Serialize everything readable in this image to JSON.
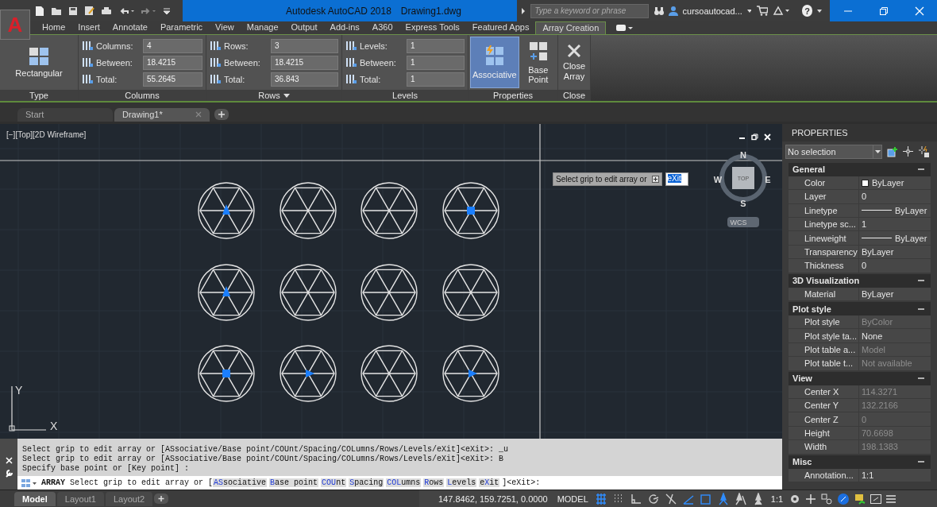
{
  "title_bar": {
    "app_letter": "A",
    "title": "Autodesk AutoCAD 2018",
    "file": "Drawing1.dwg",
    "search": {
      "placeholder": "Type a keyword or phrase"
    },
    "user": "cursoautocad...",
    "help": "?"
  },
  "ribbon_tabs": [
    {
      "label": "Home",
      "selected": false
    },
    {
      "label": "Insert",
      "selected": false
    },
    {
      "label": "Annotate",
      "selected": false
    },
    {
      "label": "Parametric",
      "selected": false
    },
    {
      "label": "View",
      "selected": false
    },
    {
      "label": "Manage",
      "selected": false
    },
    {
      "label": "Output",
      "selected": false
    },
    {
      "label": "Add-ins",
      "selected": false
    },
    {
      "label": "A360",
      "selected": false
    },
    {
      "label": "Express Tools",
      "selected": false
    },
    {
      "label": "Featured Apps",
      "selected": false
    },
    {
      "label": "Array Creation",
      "selected": true
    }
  ],
  "ribbon": {
    "type_panel": {
      "title": "Type",
      "button": "Rectangular"
    },
    "groups": [
      {
        "title": "Columns",
        "has_menu": false,
        "fields": [
          {
            "label": "Columns:",
            "value": "4"
          },
          {
            "label": "Between:",
            "value": "18.4215"
          },
          {
            "label": "Total:",
            "value": "55.2645"
          }
        ]
      },
      {
        "title": "Rows",
        "has_menu": true,
        "fields": [
          {
            "label": "Rows:",
            "value": "3"
          },
          {
            "label": "Between:",
            "value": "18.4215"
          },
          {
            "label": "Total:",
            "value": "36.843"
          }
        ]
      },
      {
        "title": "Levels",
        "has_menu": false,
        "fields": [
          {
            "label": "Levels:",
            "value": "1"
          },
          {
            "label": "Between:",
            "value": "1"
          },
          {
            "label": "Total:",
            "value": "1"
          }
        ]
      }
    ],
    "properties_panel": {
      "title": "Properties",
      "buttons": [
        {
          "label": "Associative",
          "selected": true
        },
        {
          "label": "Base Point",
          "selected": false
        }
      ]
    },
    "close_panel": {
      "title": "Close",
      "button": "Close Array"
    }
  },
  "doc_tabs": [
    {
      "label": "Start",
      "selected": false,
      "closable": false
    },
    {
      "label": "Drawing1*",
      "selected": true,
      "closable": true
    }
  ],
  "viewport": {
    "label": "[−][Top][2D Wireframe]",
    "tooltip": {
      "text": "Select grip to edit array or",
      "input": "eXit"
    },
    "viewcube": {
      "north": "N",
      "south": "S",
      "east": "E",
      "west": "W",
      "face": "TOP",
      "ucs": "WCS"
    },
    "ucs_icon": {
      "x": "X",
      "y": "Y"
    },
    "items": [
      {
        "kind": "up"
      },
      {
        "kind": "plain"
      },
      {
        "kind": "plain"
      },
      {
        "kind": "square"
      },
      {
        "kind": "up"
      },
      {
        "kind": "plain"
      },
      {
        "kind": "plain"
      },
      {
        "kind": "plain"
      },
      {
        "kind": "square"
      },
      {
        "kind": "right"
      },
      {
        "kind": "plain"
      },
      {
        "kind": "right"
      }
    ]
  },
  "properties": {
    "title": "PROPERTIES",
    "selection": "No selection",
    "sections": [
      {
        "title": "General",
        "expanded": true,
        "rows": [
          {
            "name": "Color",
            "value": "ByLayer",
            "kind": "color",
            "dimmed": false
          },
          {
            "name": "Layer",
            "value": "0",
            "kind": "text",
            "dimmed": false
          },
          {
            "name": "Linetype",
            "value": "ByLayer",
            "kind": "line",
            "dimmed": false
          },
          {
            "name": "Linetype sc...",
            "value": "1",
            "kind": "text",
            "dimmed": false
          },
          {
            "name": "Lineweight",
            "value": "ByLayer",
            "kind": "line",
            "dimmed": false
          },
          {
            "name": "Transparency",
            "value": "ByLayer",
            "kind": "text",
            "dimmed": false
          },
          {
            "name": "Thickness",
            "value": "0",
            "kind": "text",
            "dimmed": false
          }
        ]
      },
      {
        "title": "3D Visualization",
        "expanded": true,
        "rows": [
          {
            "name": "Material",
            "value": "ByLayer",
            "kind": "text",
            "dimmed": false
          }
        ]
      },
      {
        "title": "Plot style",
        "expanded": true,
        "rows": [
          {
            "name": "Plot style",
            "value": "ByColor",
            "kind": "text",
            "dimmed": true
          },
          {
            "name": "Plot style ta...",
            "value": "None",
            "kind": "text",
            "dimmed": false
          },
          {
            "name": "Plot table a...",
            "value": "Model",
            "kind": "text",
            "dimmed": true
          },
          {
            "name": "Plot table t...",
            "value": "Not available",
            "kind": "text",
            "dimmed": true
          }
        ]
      },
      {
        "title": "View",
        "expanded": true,
        "rows": [
          {
            "name": "Center X",
            "value": "114.3271",
            "kind": "text",
            "dimmed": true
          },
          {
            "name": "Center Y",
            "value": "132.2166",
            "kind": "text",
            "dimmed": true
          },
          {
            "name": "Center Z",
            "value": "0",
            "kind": "text",
            "dimmed": true
          },
          {
            "name": "Height",
            "value": "70.6698",
            "kind": "text",
            "dimmed": true
          },
          {
            "name": "Width",
            "value": "198.1383",
            "kind": "text",
            "dimmed": true
          }
        ]
      },
      {
        "title": "Misc",
        "expanded": true,
        "rows": [
          {
            "name": "Annotation...",
            "value": "1:1",
            "kind": "text",
            "dimmed": false
          }
        ]
      }
    ]
  },
  "command": {
    "history": [
      "Select grip to edit array or [ASsociative/Base point/COUnt/Spacing/COLumns/Rows/Levels/eXit]<eXit>: _u",
      "Select grip to edit array or [ASsociative/Base point/COUnt/Spacing/COLumns/Rows/Levels/eXit]<eXit>: B",
      "Specify base point or [Key point] :"
    ],
    "name": "ARRAY",
    "prompt": "Select grip to edit array or [",
    "options": [
      {
        "key": "AS",
        "rest": "sociative"
      },
      {
        "key": "B",
        "rest": "ase point"
      },
      {
        "key": "COU",
        "rest": "nt"
      },
      {
        "key": "S",
        "rest": "pacing"
      },
      {
        "key": "COL",
        "rest": "umns"
      },
      {
        "key": "R",
        "rest": "ows"
      },
      {
        "key": "L",
        "rest": "evels"
      },
      {
        "key": "X",
        "pre": "e",
        "rest": "it"
      }
    ],
    "prompt_end": "]<eXit>:"
  },
  "status_bar": {
    "layout_tabs": [
      {
        "label": "Model",
        "selected": true
      },
      {
        "label": "Layout1",
        "selected": false
      },
      {
        "label": "Layout2",
        "selected": false
      }
    ],
    "coordinates": "147.8462, 159.7251, 0.0000",
    "space": "MODEL",
    "scale": "1:1",
    "toggles": [
      {
        "kind": "grid",
        "on": true
      },
      {
        "kind": "snap",
        "on": false
      },
      {
        "kind": "ortho",
        "on": false
      },
      {
        "kind": "polar",
        "on": false
      },
      {
        "kind": "iso",
        "on": false
      },
      {
        "kind": "track",
        "on": true
      },
      {
        "kind": "osnap",
        "on": true
      },
      {
        "kind": "annotate",
        "on": true
      },
      {
        "kind": "autoscale",
        "on": false
      },
      {
        "kind": "annoscale",
        "on": false
      }
    ]
  }
}
